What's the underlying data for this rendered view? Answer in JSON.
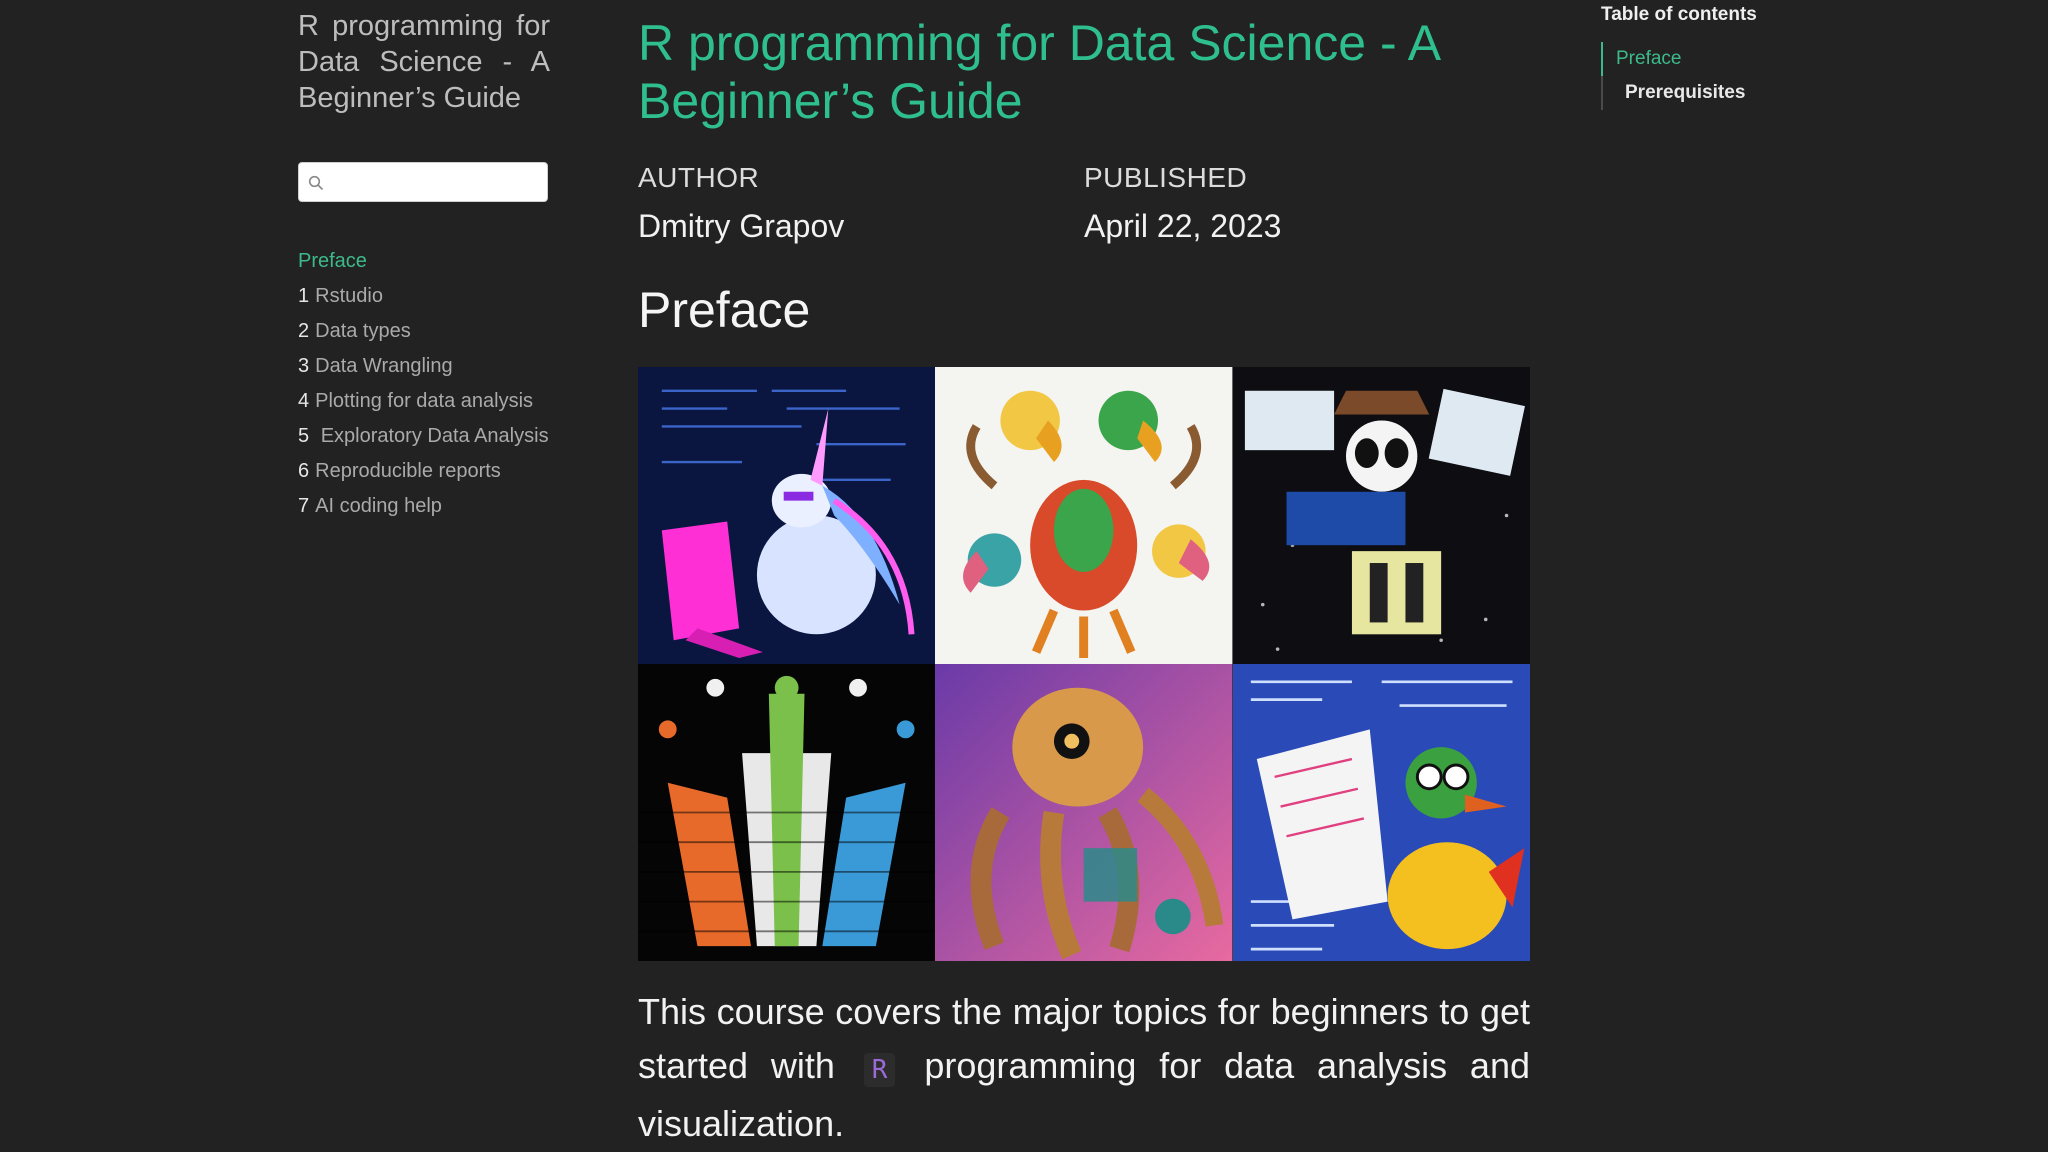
{
  "sidebar": {
    "book_title": "R programming for Data Science - A Beginner’s Guide",
    "search": {
      "placeholder": "",
      "value": ""
    },
    "nav": [
      {
        "num": "",
        "label": "Preface"
      },
      {
        "num": "1",
        "label": "Rstudio"
      },
      {
        "num": "2",
        "label": "Data types"
      },
      {
        "num": "3",
        "label": "Data Wrangling"
      },
      {
        "num": "4",
        "label": "Plotting for data analysis"
      },
      {
        "num": "5",
        "label": "Exploratory Data Analysis"
      },
      {
        "num": "6",
        "label": "Reproducible reports"
      },
      {
        "num": "7",
        "label": "AI coding help"
      }
    ]
  },
  "main": {
    "title": "R programming for Data Science - A Beginner’s Guide",
    "author_label": "AUTHOR",
    "author": "Dmitry Grapov",
    "published_label": "PUBLISHED",
    "published": "April 22, 2023",
    "section_title": "Preface",
    "body_part1": "This course covers the major topics for beginners to get started with",
    "code": "R",
    "body_part2": "programming for data analysis and visualization."
  },
  "toc": {
    "title": "Table of contents",
    "items": [
      {
        "label": "Preface"
      },
      {
        "label": "Prerequisites"
      }
    ]
  },
  "colors": {
    "accent": "#2fbf8e",
    "background": "#222222",
    "code": "#9b6ad6"
  },
  "mosaic": {
    "tiles": [
      "unicorn-coding",
      "multi-headed-bird",
      "panda-with-documents",
      "mosaic-hydra",
      "octopus-robot",
      "duck-with-paper"
    ]
  }
}
